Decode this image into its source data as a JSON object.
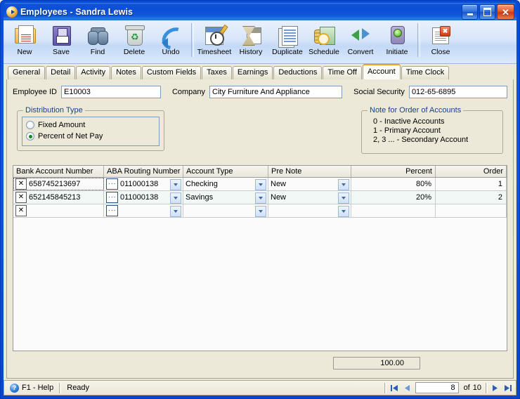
{
  "window": {
    "title": "Employees",
    "title_separator": " - ",
    "subject": "Sandra Lewis",
    "icon": "app-circle-icon",
    "buttons": {
      "minimize": "minimize-button",
      "maximize": "maximize-button",
      "close": "close-button",
      "close_glyph": "✕"
    }
  },
  "toolbar": {
    "items": [
      {
        "label": "New",
        "icon": "new-record-icon"
      },
      {
        "label": "Save",
        "icon": "floppy-disk-icon"
      },
      {
        "label": "Find",
        "icon": "binoculars-icon"
      },
      {
        "label": "Delete",
        "icon": "recycle-bin-icon"
      },
      {
        "label": "Undo",
        "icon": "undo-arrow-icon"
      },
      {
        "label": "Timesheet",
        "icon": "timesheet-icon"
      },
      {
        "label": "History",
        "icon": "hourglass-history-icon"
      },
      {
        "label": "Duplicate",
        "icon": "duplicate-icon"
      },
      {
        "label": "Schedule",
        "icon": "schedule-icon"
      },
      {
        "label": "Convert",
        "icon": "convert-arrows-icon"
      },
      {
        "label": "Initiate",
        "icon": "traffic-light-icon"
      },
      {
        "label": "Close",
        "icon": "close-document-icon"
      }
    ]
  },
  "tabs": {
    "items": [
      {
        "label": "General",
        "active": false
      },
      {
        "label": "Detail",
        "active": false
      },
      {
        "label": "Activity",
        "active": false
      },
      {
        "label": "Notes",
        "active": false
      },
      {
        "label": "Custom Fields",
        "active": false
      },
      {
        "label": "Taxes",
        "active": false
      },
      {
        "label": "Earnings",
        "active": false
      },
      {
        "label": "Deductions",
        "active": false
      },
      {
        "label": "Time Off",
        "active": false
      },
      {
        "label": "Account",
        "active": true
      },
      {
        "label": "Time Clock",
        "active": false
      }
    ],
    "active_accent_color": "#f2a11b"
  },
  "fields": {
    "employee_id_label": "Employee ID",
    "employee_id_value": "E10003",
    "company_label": "Company",
    "company_value": "City Furniture And Appliance",
    "social_security_label": "Social Security",
    "social_security_value": "012-65-6895"
  },
  "distribution": {
    "group_title": "Distribution Type",
    "options": [
      {
        "label": "Fixed Amount",
        "selected": false
      },
      {
        "label": "Percent of Net Pay",
        "selected": true
      }
    ],
    "selected_color": "#11892a"
  },
  "note": {
    "group_title": "Note for Order of Accounts",
    "lines": [
      "0 - Inactive Accounts",
      "1 - Primary Account",
      "2, 3 ... - Secondary Account"
    ]
  },
  "grid": {
    "columns": [
      {
        "label": "Bank Account Number",
        "align": "left"
      },
      {
        "label": "ABA Routing Number",
        "align": "left"
      },
      {
        "label": "Account Type",
        "align": "left"
      },
      {
        "label": "Pre Note",
        "align": "left"
      },
      {
        "label": "Percent",
        "align": "right"
      },
      {
        "label": "Order",
        "align": "right"
      }
    ],
    "delete_button_glyph": "✕",
    "browse_button_glyph": "···",
    "rows": [
      {
        "bank_account_number": "658745213697",
        "aba_routing_number": "011000138",
        "account_type": "Checking",
        "pre_note": "New",
        "percent": "80%",
        "order": "1"
      },
      {
        "bank_account_number": "652145845213",
        "aba_routing_number": "011000138",
        "account_type": "Savings",
        "pre_note": "New",
        "percent": "20%",
        "order": "2"
      },
      {
        "bank_account_number": "",
        "aba_routing_number": "",
        "account_type": "",
        "pre_note": "",
        "percent": "",
        "order": ""
      }
    ]
  },
  "total": {
    "value": "100.00"
  },
  "statusbar": {
    "help_icon": "help-question-icon",
    "help_label": "F1 - Help",
    "status_text": "Ready",
    "nav": {
      "first": "first-record-button",
      "previous": "previous-record-button",
      "next": "next-record-button",
      "last": "last-record-button",
      "record_number": "8",
      "of_label": "of",
      "record_count": "10"
    }
  }
}
